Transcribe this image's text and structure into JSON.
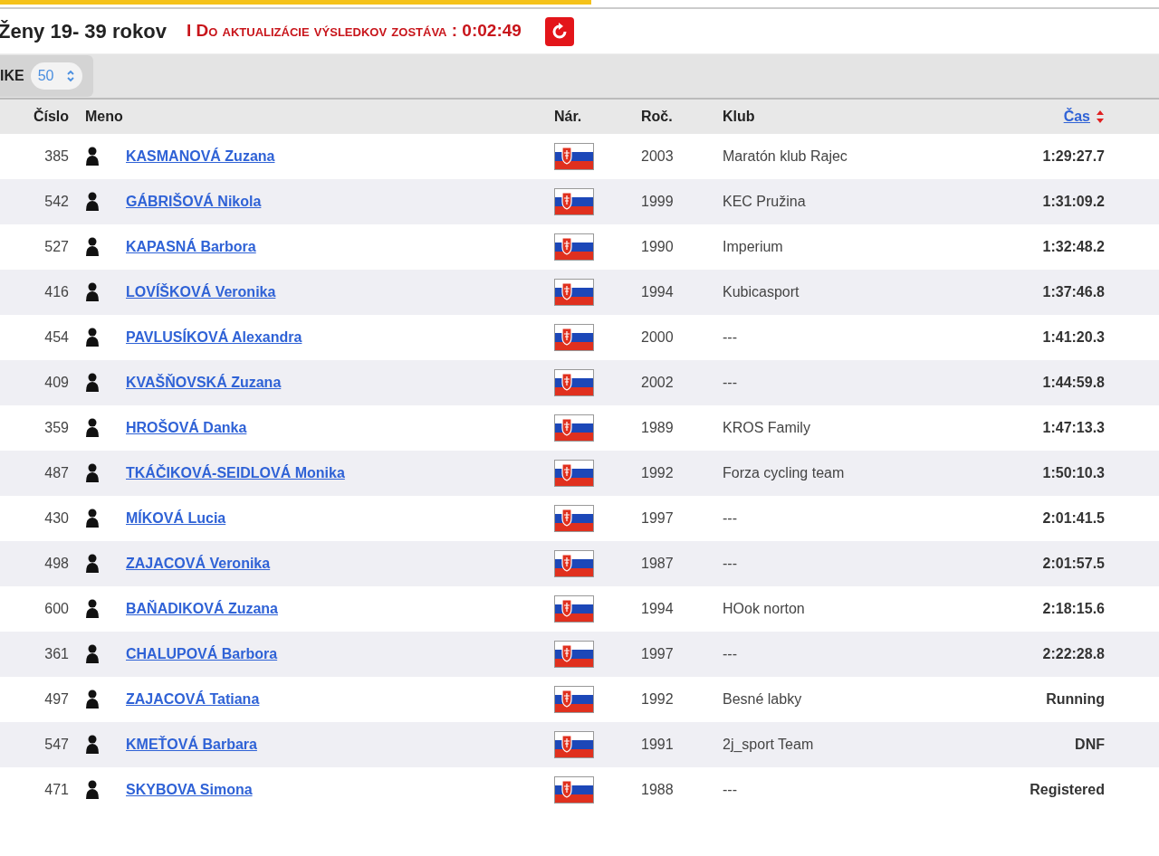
{
  "progress": {
    "level": 0.51
  },
  "heading": {
    "title": "Ženy 19- 39 rokov",
    "countdown": "I Do aktualizácie výsledkov zostáva : 0:02:49"
  },
  "toolbar": {
    "label": "IKE",
    "page_size": "50"
  },
  "table": {
    "columns": [
      {
        "label": "Číslo",
        "kind": "number"
      },
      {
        "label": "Meno",
        "kind": "name"
      },
      {
        "label": "Nár.",
        "kind": "flag"
      },
      {
        "label": "Roč.",
        "kind": "year"
      },
      {
        "label": "Klub",
        "kind": "club"
      },
      {
        "label": "Čas",
        "kind": "time",
        "sorted": true
      }
    ],
    "rows": [
      {
        "number": "385",
        "name": "KASMANOVÁ Zuzana",
        "year": "2003",
        "club": "Maratón klub Rajec",
        "time": "1:29:27.7"
      },
      {
        "number": "542",
        "name": "GÁBRIŠOVÁ Nikola",
        "year": "1999",
        "club": "KEC Pružina",
        "time": "1:31:09.2"
      },
      {
        "number": "527",
        "name": "KAPASNÁ Barbora",
        "year": "1990",
        "club": "Imperium",
        "time": "1:32:48.2"
      },
      {
        "number": "416",
        "name": "LOVÍŠKOVÁ Veronika",
        "year": "1994",
        "club": "Kubicasport",
        "time": "1:37:46.8"
      },
      {
        "number": "454",
        "name": "PAVLUSÍKOVÁ Alexandra",
        "year": "2000",
        "club": "---",
        "time": "1:41:20.3"
      },
      {
        "number": "409",
        "name": "KVAŠŇOVSKÁ Zuzana",
        "year": "2002",
        "club": "---",
        "time": "1:44:59.8"
      },
      {
        "number": "359",
        "name": "HROŠOVÁ Danka",
        "year": "1989",
        "club": "KROS Family",
        "time": "1:47:13.3"
      },
      {
        "number": "487",
        "name": "TKÁČIKOVÁ-SEIDLOVÁ Monika",
        "year": "1992",
        "club": "Forza cycling team",
        "time": "1:50:10.3"
      },
      {
        "number": "430",
        "name": "MÍKOVÁ Lucia",
        "year": "1997",
        "club": "---",
        "time": "2:01:41.5"
      },
      {
        "number": "498",
        "name": "ZAJACOVÁ Veronika",
        "year": "1987",
        "club": "---",
        "time": "2:01:57.5"
      },
      {
        "number": "600",
        "name": "BAŇADIKOVÁ Zuzana",
        "year": "1994",
        "club": "HOok norton",
        "time": "2:18:15.6"
      },
      {
        "number": "361",
        "name": "CHALUPOVÁ Barbora",
        "year": "1997",
        "club": "---",
        "time": "2:22:28.8"
      },
      {
        "number": "497",
        "name": "ZAJACOVÁ Tatiana",
        "year": "1992",
        "club": "Besné labky",
        "time": "Running"
      },
      {
        "number": "547",
        "name": "KMEŤOVÁ Barbara",
        "year": "1991",
        "club": "2j_sport Team",
        "time": "DNF"
      },
      {
        "number": "471",
        "name": "SKYBOVA Simona",
        "year": "1988",
        "club": "---",
        "time": "Registered"
      }
    ]
  }
}
